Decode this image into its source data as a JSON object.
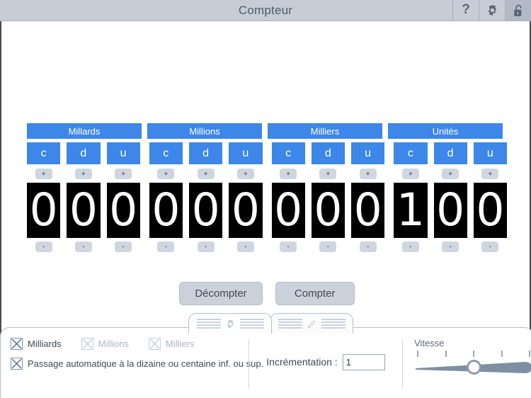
{
  "titlebar": {
    "title": "Compteur",
    "help_label": "?",
    "gear_icon": "gear-icon",
    "lock_icon": "unlocked-padlock-icon"
  },
  "counter": {
    "groups": [
      "Millards",
      "Millions",
      "Milliers",
      "Unités"
    ],
    "place_labels": [
      "c",
      "d",
      "u"
    ],
    "increase_label": "+",
    "decrease_label": "-",
    "digits": [
      "0",
      "0",
      "0",
      "0",
      "0",
      "0",
      "0",
      "0",
      "0",
      "1",
      "0",
      "0"
    ],
    "value": "000000000100",
    "colors": {
      "header_blue": "#3c87e8",
      "digit_background": "#000000",
      "digit_text": "#ffffff"
    }
  },
  "actions": {
    "count_down_label": "Décompter",
    "count_up_label": "Compter"
  },
  "drawer": {
    "tabs": [
      {
        "icon": "gear-icon",
        "active": true
      },
      {
        "icon": "pencil-icon",
        "active": false
      }
    ],
    "checkboxes": [
      {
        "label": "Milliards",
        "checked": true,
        "enabled": true
      },
      {
        "label": "Millions",
        "checked": true,
        "enabled": false
      },
      {
        "label": "Milliers",
        "checked": true,
        "enabled": false
      }
    ],
    "auto_option": {
      "label": "Passage automatique à la dizaine ou centaine inf. ou sup.",
      "checked": true
    },
    "increment": {
      "label": "Incrémentation :",
      "value": "1",
      "placeholder": ""
    },
    "speed": {
      "label": "Vitesse",
      "ticks": 5,
      "position_percent": 50
    }
  }
}
